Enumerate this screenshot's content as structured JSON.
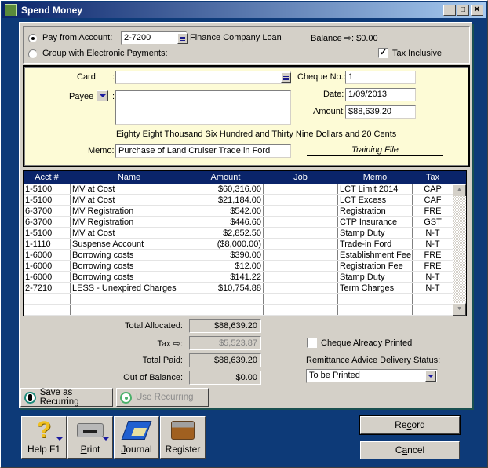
{
  "window": {
    "title": "Spend Money",
    "controls": [
      "minimize",
      "maximize",
      "close"
    ]
  },
  "top": {
    "pay_from_label": "Pay from Account:",
    "pay_from_selected": true,
    "account_number": "2-7200",
    "account_name": "Finance Company Loan",
    "balance_label": "Balance ⇨: $0.00",
    "group_label": "Group with Electronic Payments:",
    "group_selected": false,
    "tax_inclusive_label": "Tax Inclusive",
    "tax_inclusive_checked": true
  },
  "cheque": {
    "card_label": "Card",
    "card_value": "",
    "payee_label": "Payee",
    "payee_value": "",
    "cheque_no_label": "Cheque No.:",
    "cheque_no": "1",
    "date_label": "Date:",
    "date": "1/09/2013",
    "amount_label": "Amount:",
    "amount": "$88,639.20",
    "amount_words": "Eighty Eight Thousand Six Hundred and Thirty Nine Dollars and 20 Cents",
    "memo_label": "Memo:",
    "memo": "Purchase of Land Cruiser Trade in Ford",
    "signature_text": "Training File"
  },
  "grid": {
    "headers": [
      "Acct #",
      "Name",
      "Amount",
      "Job",
      "Memo",
      "Tax"
    ],
    "rows": [
      [
        "1-5100",
        "MV at Cost",
        "$60,316.00",
        "",
        "LCT Limit 2014",
        "CAP"
      ],
      [
        "1-5100",
        "MV at Cost",
        "$21,184.00",
        "",
        "LCT Excess",
        "CAF"
      ],
      [
        "6-3700",
        "MV Registration",
        "$542.00",
        "",
        "Registration",
        "FRE"
      ],
      [
        "6-3700",
        "MV Registration",
        "$446.60",
        "",
        "CTP Insurance",
        "GST"
      ],
      [
        "1-5100",
        "MV at Cost",
        "$2,852.50",
        "",
        "Stamp Duty",
        "N-T"
      ],
      [
        "1-1110",
        "Suspense Account",
        "($8,000.00)",
        "",
        "Trade-in Ford",
        "N-T"
      ],
      [
        "1-6000",
        "Borrowing costs",
        "$390.00",
        "",
        "Establishment Fee",
        "FRE"
      ],
      [
        "1-6000",
        "Borrowing costs",
        "$12.00",
        "",
        "Registration Fee",
        "FRE"
      ],
      [
        "1-6000",
        "Borrowing costs",
        "$141.22",
        "",
        "Stamp Duty",
        "N-T"
      ],
      [
        "2-7210",
        "LESS - Unexpired Charges",
        "$10,754.88",
        "",
        "Term Charges",
        "N-T"
      ],
      [
        "",
        "",
        "",
        "",
        "",
        ""
      ],
      [
        "",
        "",
        "",
        "",
        "",
        ""
      ]
    ]
  },
  "totals": {
    "allocated_label": "Total Allocated:",
    "allocated": "$88,639.20",
    "tax_label": "Tax ⇨:",
    "tax": "$5,523.87",
    "paid_label": "Total Paid:",
    "paid": "$88,639.20",
    "oob_label": "Out of Balance:",
    "oob": "$0.00"
  },
  "options": {
    "cheque_printed_label": "Cheque Already Printed",
    "cheque_printed_checked": false,
    "remittance_label": "Remittance Advice Delivery Status:",
    "remittance_value": "To be Printed"
  },
  "recurring": {
    "save": "Save as Recurring",
    "use": "Use Recurring"
  },
  "toolbar": {
    "help": "Help F1",
    "print": "Print",
    "journal": "Journal",
    "register": "Register"
  },
  "actions": {
    "record": "Record",
    "cancel": "Cancel"
  }
}
